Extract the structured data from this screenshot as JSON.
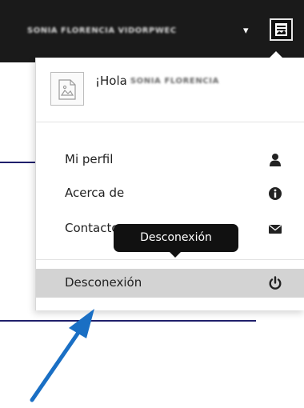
{
  "topbar": {
    "user_name": "SONIA FLORENCIA VIDORPWEC",
    "caret": "▾",
    "avatar_icon": "user-avatar-icon"
  },
  "dropdown": {
    "greeting": "¡Hola",
    "greeting_name": "SONIA FLORENCIA",
    "items": [
      {
        "label": "Mi perfil",
        "icon": "user-icon"
      },
      {
        "label": "Acerca de",
        "icon": "info-icon"
      },
      {
        "label": "Contacto",
        "icon": "envelope-icon"
      },
      {
        "label": "Desconexión",
        "icon": "power-icon"
      }
    ]
  },
  "tooltip": {
    "text": "Desconexión"
  },
  "colors": {
    "topbar": "#1a1a1a",
    "highlight": "#d3d3d3",
    "tooltip": "#111111",
    "arrow": "#1a6fc4",
    "accent_line": "#1f1f6b"
  }
}
